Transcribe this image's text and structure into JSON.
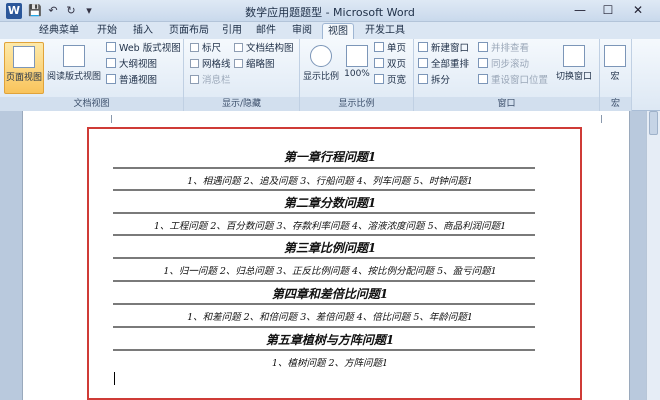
{
  "window": {
    "title": "数学应用题题型 - Microsoft Word",
    "controls": {
      "minimize": "—",
      "maximize": "☐",
      "close": "✕"
    }
  },
  "quick_access": [
    "save-icon",
    "undo-icon",
    "redo-icon",
    "customize-icon"
  ],
  "tabs": [
    "经典菜单",
    "开始",
    "插入",
    "页面布局",
    "引用",
    "邮件",
    "审阅",
    "视图",
    "开发工具"
  ],
  "active_tab": "视图",
  "ribbon": {
    "doc_views": {
      "label": "文档视图",
      "print_layout": "页面视图",
      "reading": "阅读版式视图",
      "web": "Web 版式视图",
      "outline": "大纲视图",
      "draft": "普通视图"
    },
    "show_hide": {
      "label": "显示/隐藏",
      "ruler": "标尺",
      "gridlines": "网格线",
      "message_bar": "消息栏",
      "doc_map": "文档结构图",
      "thumbnails": "缩略图"
    },
    "zoom": {
      "label": "显示比例",
      "zoom": "显示比例",
      "hundred": "100%",
      "one_page": "单页",
      "two_pages": "双页",
      "page_width": "页宽"
    },
    "window_group": {
      "label": "窗口",
      "new_window": "新建窗口",
      "arrange_all": "全部重排",
      "split": "拆分",
      "side_by_side": "并排查看",
      "sync_scroll": "同步滚动",
      "reset_position": "重设窗口位置",
      "switch_windows": "切换窗口"
    },
    "macros": {
      "label": "宏",
      "macros": "宏"
    }
  },
  "document": {
    "sections": [
      {
        "title": "第一章行程问题1",
        "items": "1、相遇问题 2、追及问题 3、行船问题 4、列车问题 5、时钟问题1"
      },
      {
        "title": "第二章分数问题1",
        "items": "1、工程问题 2、百分数问题 3、存款利率问题 4、溶液浓度问题 5、商品利润问题1"
      },
      {
        "title": "第三章比例问题1",
        "items": "1、归一问题 2、归总问题 3、正反比例问题 4、按比例分配问题 5、盈亏问题1"
      },
      {
        "title": "第四章和差倍比问题1",
        "items": "1、和差问题 2、和倍问题 3、差倍问题 4、倍比问题 5、年龄问题1"
      },
      {
        "title": "第五章植树与方阵问题1",
        "items": "1、植树问题 2、方阵问题1"
      }
    ]
  }
}
